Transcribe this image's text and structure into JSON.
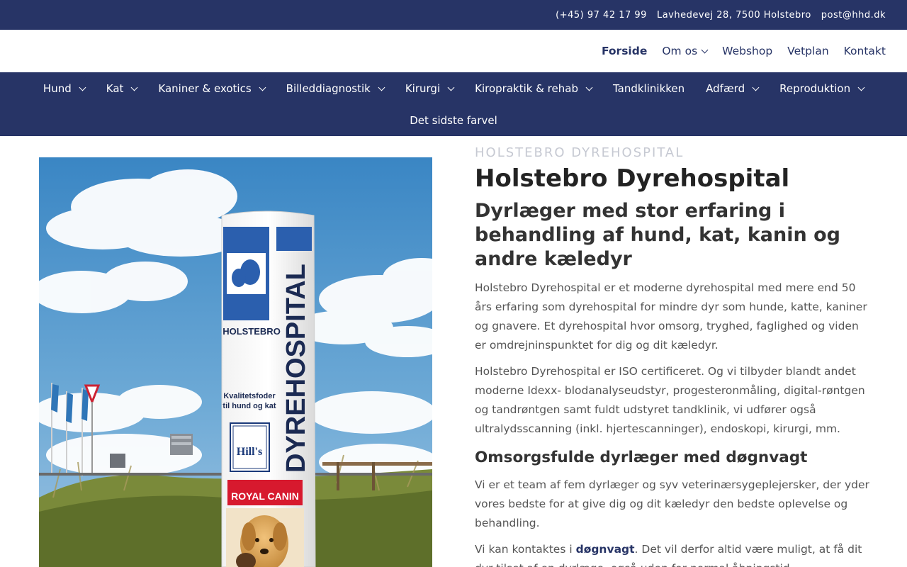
{
  "topbar": {
    "phone": "(+45) 97 42 17 99",
    "address": "Lavhedevej 28, 7500 Holstebro",
    "email": "post@hhd.dk"
  },
  "secondary_nav": {
    "items": [
      {
        "label": "Forside",
        "active": true
      },
      {
        "label": "Om os",
        "dropdown": true
      },
      {
        "label": "Webshop"
      },
      {
        "label": "Vetplan"
      },
      {
        "label": "Kontakt"
      }
    ]
  },
  "main_nav": {
    "items": [
      {
        "label": "Hund"
      },
      {
        "label": "Kat"
      },
      {
        "label": "Kaniner & exotics"
      },
      {
        "label": "Billeddiagnostik"
      },
      {
        "label": "Kirurgi"
      },
      {
        "label": "Kiropraktik & rehab"
      },
      {
        "label": "Tandklinikken"
      },
      {
        "label": "Adfærd"
      },
      {
        "label": "Reproduktion"
      },
      {
        "label": "Det sidste farvel"
      }
    ]
  },
  "hero_image": {
    "sign_text": "DYREHOSPITAL",
    "sign_city": "HOLSTEBRO",
    "sign_tagline_1": "Kvalitetsfoder",
    "sign_tagline_2": "til hund og kat",
    "brand_1": "Hill's",
    "brand_2": "ROYAL CANIN"
  },
  "content": {
    "eyebrow": "HOLSTEBRO DYREHOSPITAL",
    "title": "Holstebro Dyrehospital",
    "subtitle": "Dyrlæger med stor erfaring i behandling af hund, kat, kanin og andre kæledyr",
    "para1": "Holstebro Dyrehospital er et moderne dyrehospital med mere end 50 års erfaring som dyrehospital for mindre dyr som hunde, katte, kaniner og gnavere. Et dyrehospital hvor omsorg, tryghed, faglighed og viden er omdrejninspunktet for dig og dit kæledyr.",
    "para2": "Holstebro Dyrehospital er ISO certificeret. Og vi tilbyder blandt andet moderne Idexx- blodanalyseudstyr, progesteronmåling, digital-røntgen og tandrøntgen samt fuldt udstyret tandklinik, vi udfører også ultralydsscanning (inkl. hjertescanninger), endoskopi, kirurgi, mm.",
    "heading2": "Omsorgsfulde dyrlæger med døgnvagt",
    "para3": "Vi er et team af fem dyrlæger og syv veterinærsygeplejersker, der yder vores bedste for at give dig og dit kæledyr den bedste oplevelse og behandling.",
    "para4_before": "Vi kan kontaktes i ",
    "para4_link": "døgnvagt",
    "para4_after": ". Det vil derfor altid være muligt, at få dit dyr tilset af en dyrlæge, også uden for normal åbningstid."
  },
  "colors": {
    "navy": "#273466",
    "sky": "#3f8fc8",
    "text": "#555555"
  }
}
